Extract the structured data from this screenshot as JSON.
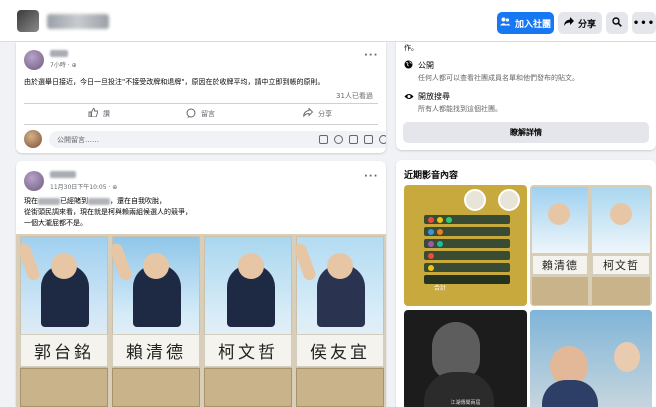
{
  "header": {
    "join_label": "加入社團",
    "share_label": "分享"
  },
  "post1": {
    "time": "7小時",
    "text_line": "由於選舉日接近，今日一旦投注\"不接受改牌和退牌\"，原因在於收牌平均，請中立即到帳的原則。",
    "seen_count": "31人已看過",
    "like_label": "讚",
    "comment_label": "留言",
    "share_label": "分享",
    "comment_placeholder": "公開留言……"
  },
  "post2": {
    "time": "11月30日下午10:05",
    "line1_before": "現在",
    "line1_mid": "已經賭到",
    "line1_after": "，還在自我吹脫，",
    "line2": "從街頭民調來看，現在就是柯與賴兩組候選人的競爭，",
    "line3": "一個大瀧屁都不是。",
    "candidate_names": [
      "郭台銘",
      "賴清德",
      "柯文哲",
      "侯友宜"
    ]
  },
  "about": {
    "top_text": "作。",
    "public_title": "公開",
    "public_desc": "任何人都可以查看社團成員名單和他們發布的貼文。",
    "searchable_title": "開放搜尋",
    "searchable_desc": "所有人都能找到這個社團。",
    "learn_more_label": "瞭解詳情"
  },
  "media": {
    "title": "近期影音內容",
    "thumb1_label": "合計",
    "thumb2_names": [
      "賴清德",
      "柯文哲"
    ],
    "thumb3_caption": "江湖傳聞兩屆"
  },
  "colors": {
    "accent": "#1877f2",
    "background": "#f0f2f5",
    "muted_text": "#65676b"
  },
  "icons": [
    "group-add-icon",
    "share-arrow-icon",
    "search-icon",
    "more-icon",
    "like-icon",
    "comment-icon",
    "share-icon",
    "globe-icon",
    "eye-icon"
  ]
}
